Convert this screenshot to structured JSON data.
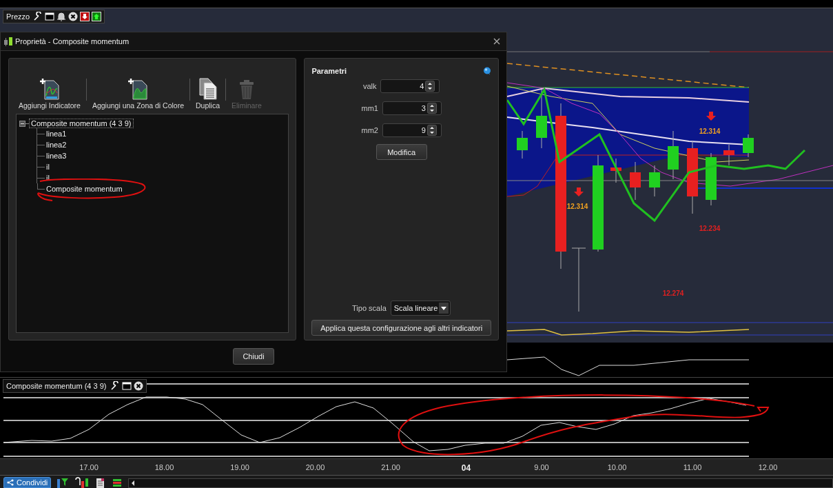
{
  "price_pane": {
    "title": "Prezzo",
    "labels": [
      {
        "text": "12.314",
        "color": "#f0a020",
        "arrow": true
      },
      {
        "text": "12.314",
        "color": "#f0a020",
        "arrow": true
      },
      {
        "text": "12.234",
        "color": "#e02020",
        "arrow": false
      },
      {
        "text": "12.274",
        "color": "#e02020",
        "arrow": false
      }
    ]
  },
  "dialog": {
    "title": "Proprietà - Composite momentum",
    "toolbar": [
      {
        "label": "Aggiungi Indicatore",
        "kind": "add-indicator",
        "disabled": false
      },
      {
        "label": "Aggiungi una Zona di Colore",
        "kind": "add-zone",
        "disabled": false
      },
      {
        "label": "Duplica",
        "kind": "duplicate",
        "disabled": false
      },
      {
        "label": "Eliminare",
        "kind": "delete",
        "disabled": true
      }
    ],
    "tree": {
      "label": "Composite momentum (4 3 9)",
      "expanded": true,
      "selected": true,
      "children": [
        {
          "label": "linea1",
          "selected": false
        },
        {
          "label": "linea2",
          "selected": false
        },
        {
          "label": "linea3",
          "selected": false
        },
        {
          "label": "il",
          "selected": false
        },
        {
          "label": "il",
          "selected": false
        },
        {
          "label": "Composite momentum",
          "selected": false
        }
      ]
    },
    "params": {
      "title": "Parametri",
      "fields": [
        {
          "label": "valk",
          "value": "4"
        },
        {
          "label": "mm1",
          "value": "3"
        },
        {
          "label": "mm2",
          "value": "9"
        }
      ],
      "modify_button": "Modifica",
      "scale_label": "Tipo scala",
      "scale_value": "Scala lineare",
      "apply_button": "Applica questa configurazione agli altri indicatori"
    },
    "close_button": "Chiudi"
  },
  "indicator_pane": {
    "title": "Composite momentum (4 3 9)"
  },
  "time_axis": [
    {
      "label": "17.00",
      "bold": false
    },
    {
      "label": "18.00",
      "bold": false
    },
    {
      "label": "19.00",
      "bold": false
    },
    {
      "label": "20.00",
      "bold": false
    },
    {
      "label": "21.00",
      "bold": false
    },
    {
      "label": "04",
      "bold": true
    },
    {
      "label": "9.00",
      "bold": false
    },
    {
      "label": "10.00",
      "bold": false
    },
    {
      "label": "11.00",
      "bold": false
    },
    {
      "label": "12.00",
      "bold": false
    }
  ],
  "bottom_toolbar": {
    "share_button": "Condividi"
  }
}
